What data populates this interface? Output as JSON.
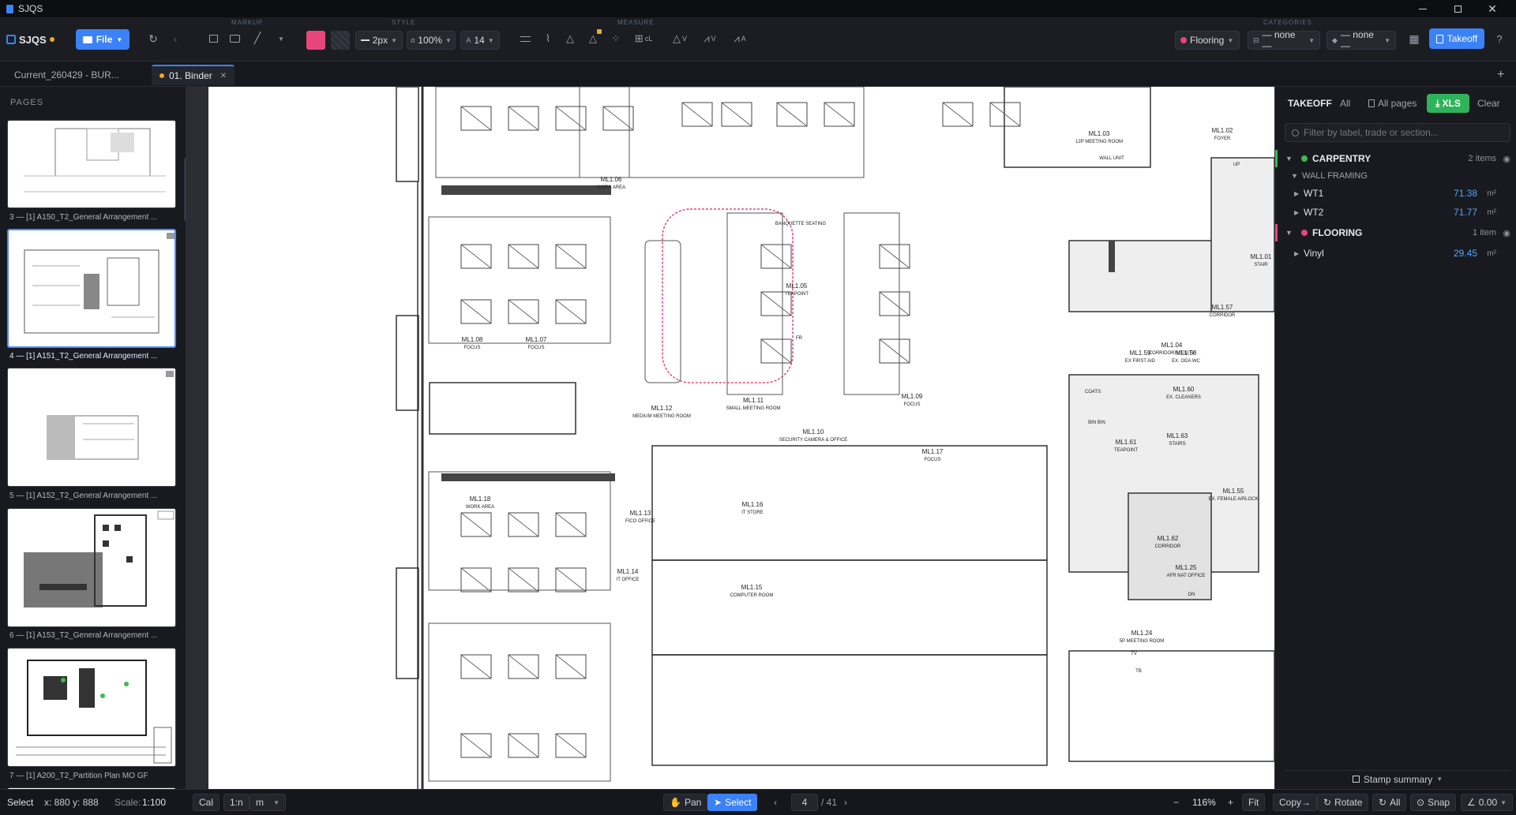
{
  "app": {
    "title": "SJQS"
  },
  "toolbar": {
    "logo": "SJQS",
    "file_label": "File",
    "groups": {
      "markup": "MARKUP",
      "style": "STYLE",
      "measure": "MEASURE",
      "categories": "CATEGORIES"
    },
    "stroke": "2px",
    "opacity": "100%",
    "font_size": "14",
    "measure_labels": {
      "count_grid": "cL",
      "vertex": "V",
      "vertex_line": "V",
      "area_label": "A"
    },
    "category_select": "Flooring",
    "trade_select": "— none —",
    "section_select": "— none —",
    "takeoff_button": "Takeoff",
    "help": "?",
    "colors": {
      "accent": "#3b82f6",
      "fill": "#e8467a"
    }
  },
  "tabs": [
    {
      "label": "Current_260429 - BUR..."
    },
    {
      "label": "01. Binder"
    }
  ],
  "sidebar": {
    "heading": "PAGES",
    "pages": [
      {
        "label": "3 — [1] A150_T2_General Arrangement ..."
      },
      {
        "label": "4 — [1] A151_T2_General Arrangement ..."
      },
      {
        "label": "5 — [1] A152_T2_General Arrangement ..."
      },
      {
        "label": "6 — [1] A153_T2_General Arrangement ..."
      },
      {
        "label": "7 — [1] A200_T2_Partition Plan MO GF"
      }
    ]
  },
  "drawing": {
    "rooms": [
      {
        "id": "ML1.03",
        "name": "12P MEETING ROOM"
      },
      {
        "id": "ML1.02",
        "name": "FOYER"
      },
      {
        "id": "ML1.06",
        "name": "WORK AREA"
      },
      {
        "id": "ML1.05",
        "name": "TEAPOINT"
      },
      {
        "id": "ML1.08",
        "name": "FOCUS"
      },
      {
        "id": "ML1.07",
        "name": "FOCUS"
      },
      {
        "id": "ML1.04",
        "name": "CORRIDOR/ UTILITY"
      },
      {
        "id": "ML1.57",
        "name": "CORRIDOR"
      },
      {
        "id": "ML1.01",
        "name": "STAIR"
      },
      {
        "id": "ML1.59",
        "name": "EX FIRST AID"
      },
      {
        "id": "ML1.58",
        "name": "EX. ODA WC"
      },
      {
        "id": "ML1.60",
        "name": "EX. CLEANERS"
      },
      {
        "id": "ML1.12",
        "name": "MEDIUM MEETING ROOM"
      },
      {
        "id": "ML1.11",
        "name": "SMALL MEETING ROOM"
      },
      {
        "id": "ML1.10",
        "name": "SECURITY CAMERA & OFFICE"
      },
      {
        "id": "ML1.09",
        "name": "FOCUS"
      },
      {
        "id": "ML1.17",
        "name": "FOCUS"
      },
      {
        "id": "ML1.61",
        "name": "TEAPOINT"
      },
      {
        "id": "ML1.63",
        "name": "STAIRS"
      },
      {
        "id": "ML1.55",
        "name": "EX. FEMALE AIRLOCK"
      },
      {
        "id": "ML1.18",
        "name": "WORK AREA"
      },
      {
        "id": "ML1.13",
        "name": "FICO OFFICE"
      },
      {
        "id": "ML1.16",
        "name": "IT STORE"
      },
      {
        "id": "ML1.62",
        "name": "CORRIDOR"
      },
      {
        "id": "ML1.14",
        "name": "IT OFFICE"
      },
      {
        "id": "ML1.15",
        "name": "COMPUTER ROOM"
      },
      {
        "id": "ML1.25",
        "name": "AFR NAT OFFICE"
      },
      {
        "id": "ML1.24",
        "name": "5P MEETING ROOM"
      }
    ],
    "misc": {
      "coats": "COATS",
      "bin": "BIN BIN",
      "banquette": "BANQUETTE SEATING",
      "fr": "FR",
      "up": "UP",
      "dn": "DN",
      "tv": "TV",
      "wall_unit": "WALL UNIT",
      "tb": "TB"
    }
  },
  "takeoff": {
    "title": "TAKEOFF",
    "all": "All",
    "all_pages": "All pages",
    "xls": "XLS",
    "clear": "Clear",
    "filter_placeholder": "Filter by label, trade or section...",
    "sections": [
      {
        "name": "CARPENTRY",
        "count": "2 items",
        "color": "#3fb950",
        "subgroups": [
          {
            "name": "WALL FRAMING",
            "items": [
              {
                "label": "WT1",
                "value": "71.38",
                "unit": "m²"
              },
              {
                "label": "WT2",
                "value": "71.77",
                "unit": "m²"
              }
            ]
          }
        ]
      },
      {
        "name": "FLOORING",
        "count": "1 item",
        "color": "#e8467a",
        "items": [
          {
            "label": "Vinyl",
            "value": "29.45",
            "unit": "m²"
          }
        ]
      }
    ],
    "stamp_summary": "Stamp summary"
  },
  "status": {
    "mode": "Select",
    "coords": "x: 880 y: 888",
    "scale_label": "Scale:",
    "scale": "1:100",
    "cal": "Cal",
    "ratio": "1:n",
    "unit": "m",
    "pan": "Pan",
    "select": "Select",
    "page": "4",
    "total": "/ 41",
    "zoom": "116%",
    "fit": "Fit",
    "copy": "Copy→",
    "rotate": "Rotate",
    "all": "All",
    "snap": "Snap",
    "angle": "0.00"
  }
}
